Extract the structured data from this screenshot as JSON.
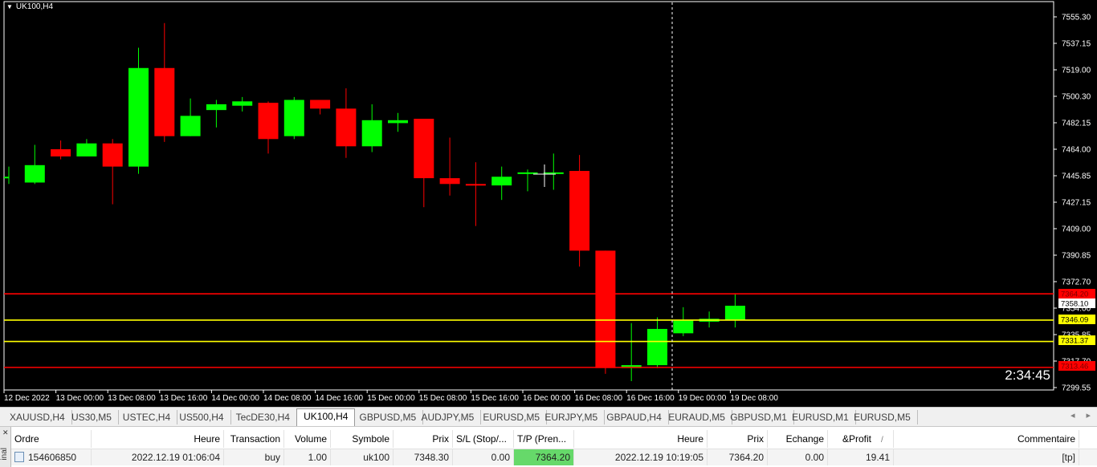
{
  "chart": {
    "title": "UK100,H4",
    "countdown": "2:34:45",
    "colors": {
      "background": "#000000",
      "bull": "#00ff00",
      "bear": "#ff0000",
      "stop_line": "#ff0000",
      "level_line": "#ffff00",
      "grid": "#ffffff"
    },
    "price_ticks": [
      "7555.30",
      "7537.15",
      "7519.00",
      "7500.30",
      "7482.15",
      "7464.00",
      "7445.85",
      "7427.15",
      "7409.00",
      "7390.85",
      "7372.70",
      "7354.00",
      "7335.85",
      "7317.70",
      "7299.55"
    ],
    "time_labels": [
      "12 Dec 2022",
      "13 Dec 00:00",
      "13 Dec 08:00",
      "13 Dec 16:00",
      "14 Dec 00:00",
      "14 Dec 08:00",
      "14 Dec 16:00",
      "15 Dec 00:00",
      "15 Dec 08:00",
      "15 Dec 16:00",
      "16 Dec 00:00",
      "16 Dec 08:00",
      "16 Dec 16:00",
      "19 Dec 00:00",
      "19 Dec 08:00"
    ],
    "price_tags": [
      {
        "value": "7364.20",
        "kind": "red"
      },
      {
        "value": "7358.10",
        "kind": "white"
      },
      {
        "value": "7346.09",
        "kind": "yellow"
      },
      {
        "value": "7331.37",
        "kind": "yellow"
      },
      {
        "value": "7313.46",
        "kind": "red"
      }
    ]
  },
  "chart_data": {
    "type": "candlestick",
    "symbol": "UK100",
    "timeframe": "H4",
    "ylim": [
      7299.55,
      7555.3
    ],
    "horizontal_levels": [
      7364.2,
      7346.09,
      7331.37,
      7313.46
    ],
    "current_price": 7358.1,
    "candles": [
      {
        "o": 7445,
        "h": 7452,
        "l": 7440,
        "c": 7445
      },
      {
        "o": 7441,
        "h": 7467,
        "l": 7440,
        "c": 7453
      },
      {
        "o": 7464,
        "h": 7470,
        "l": 7457,
        "c": 7459
      },
      {
        "o": 7459,
        "h": 7471,
        "l": 7459,
        "c": 7468
      },
      {
        "o": 7468,
        "h": 7471,
        "l": 7426,
        "c": 7452
      },
      {
        "o": 7452,
        "h": 7534,
        "l": 7447,
        "c": 7520
      },
      {
        "o": 7520,
        "h": 7551,
        "l": 7469,
        "c": 7473
      },
      {
        "o": 7473,
        "h": 7499,
        "l": 7473,
        "c": 7487
      },
      {
        "o": 7491,
        "h": 7498,
        "l": 7479,
        "c": 7495
      },
      {
        "o": 7494,
        "h": 7500,
        "l": 7490,
        "c": 7497
      },
      {
        "o": 7496,
        "h": 7497,
        "l": 7461,
        "c": 7471
      },
      {
        "o": 7473,
        "h": 7500,
        "l": 7471,
        "c": 7498
      },
      {
        "o": 7498,
        "h": 7498,
        "l": 7488,
        "c": 7492
      },
      {
        "o": 7492,
        "h": 7506,
        "l": 7458,
        "c": 7466
      },
      {
        "o": 7466,
        "h": 7495,
        "l": 7462,
        "c": 7484
      },
      {
        "o": 7482,
        "h": 7489,
        "l": 7476,
        "c": 7484
      },
      {
        "o": 7485,
        "h": 7485,
        "l": 7424,
        "c": 7444
      },
      {
        "o": 7444,
        "h": 7472,
        "l": 7432,
        "c": 7440
      },
      {
        "o": 7440,
        "h": 7455,
        "l": 7411,
        "c": 7439
      },
      {
        "o": 7439,
        "h": 7452,
        "l": 7429,
        "c": 7445
      },
      {
        "o": 7447,
        "h": 7450,
        "l": 7435,
        "c": 7448
      },
      {
        "o": 7448,
        "h": 7461,
        "l": 7436,
        "c": 7448
      },
      {
        "o": 7449,
        "h": 7460,
        "l": 7383,
        "c": 7394
      },
      {
        "o": 7394,
        "h": 7394,
        "l": 7309,
        "c": 7313
      },
      {
        "o": 7313,
        "h": 7344,
        "l": 7304,
        "c": 7315
      },
      {
        "o": 7315,
        "h": 7348,
        "l": 7313,
        "c": 7340
      },
      {
        "o": 7337,
        "h": 7355,
        "l": 7335,
        "c": 7346
      },
      {
        "o": 7345,
        "h": 7352,
        "l": 7341,
        "c": 7347
      },
      {
        "o": 7346,
        "h": 7364,
        "l": 7341,
        "c": 7356
      }
    ]
  },
  "tabs": {
    "items": [
      "XAUUSD,H4",
      "US30,M5",
      "USTEC,H4",
      "US500,H4",
      "TecDE30,H4",
      "UK100,H4",
      "GBPUSD,M5",
      "AUDJPY,M5",
      "EURUSD,M5",
      "EURJPY,M5",
      "GBPAUD,H4",
      "EURAUD,M5",
      "GBPUSD,M1",
      "EURUSD,M1",
      "EURUSD,M5"
    ],
    "active": "UK100,H4",
    "left_arrow": "◂",
    "right_arrow": "▸"
  },
  "terminal": {
    "side_label": "inal",
    "close_glyph": "✕",
    "headers": [
      "Ordre",
      "Heure",
      "Transaction",
      "Volume",
      "Symbole",
      "Prix",
      "S/L (Stop/...",
      "T/P (Pren...",
      "Heure",
      "Prix",
      "Echange",
      "&Profit",
      "Commentaire"
    ],
    "profit_sort_glyph": "/",
    "row": {
      "ordre": "154606850",
      "heure": "2022.12.19 01:06:04",
      "transaction": "buy",
      "volume": "1.00",
      "symbole": "uk100",
      "prix": "7348.30",
      "sl": "0.00",
      "tp": "7364.20",
      "heure2": "2022.12.19 10:19:05",
      "prix2": "7364.20",
      "echange": "0.00",
      "profit": "19.41",
      "commentaire": "[tp]"
    }
  }
}
